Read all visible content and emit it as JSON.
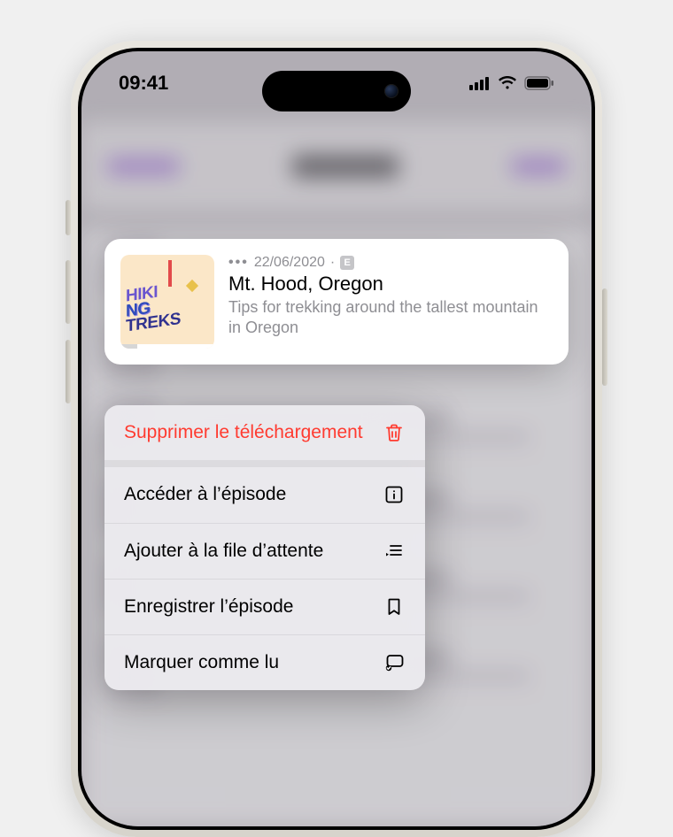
{
  "status_bar": {
    "time": "09:41"
  },
  "episode": {
    "artwork_line1": "HIKI",
    "artwork_line2": "NG",
    "artwork_line3": "TREKS",
    "date": "22/06/2020",
    "explicit": "E",
    "title": "Mt. Hood, Oregon",
    "description": "Tips for trekking around the tallest mountain in Oregon"
  },
  "menu": {
    "remove_download": "Supprimer le téléchargement",
    "go_to_episode": "Accéder à l’épisode",
    "add_to_queue": "Ajouter à la file d’attente",
    "save_episode": "Enregistrer l’épisode",
    "mark_as_read": "Marquer comme lu"
  }
}
